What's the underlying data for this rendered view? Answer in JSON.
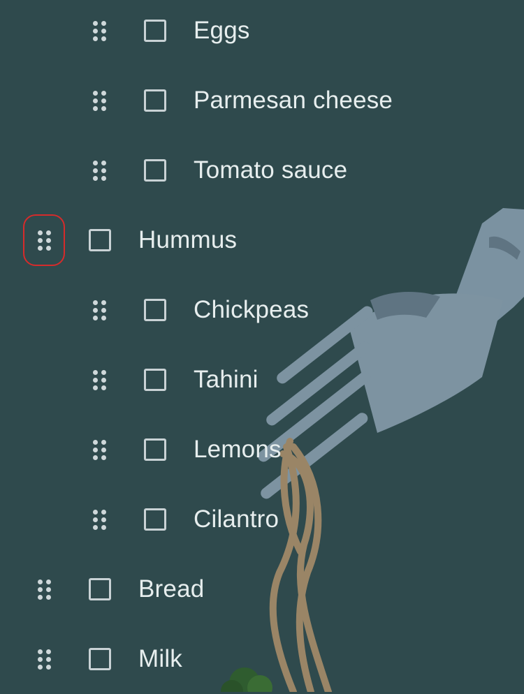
{
  "list": {
    "items": [
      {
        "label": "Eggs",
        "level": 1,
        "checked": false
      },
      {
        "label": "Parmesan cheese",
        "level": 1,
        "checked": false
      },
      {
        "label": "Tomato sauce",
        "level": 1,
        "checked": false
      },
      {
        "label": "Hummus",
        "level": 0,
        "checked": false,
        "highlighted": true
      },
      {
        "label": "Chickpeas",
        "level": 1,
        "checked": false
      },
      {
        "label": "Tahini",
        "level": 1,
        "checked": false
      },
      {
        "label": "Lemons",
        "level": 1,
        "checked": false
      },
      {
        "label": "Cilantro",
        "level": 1,
        "checked": false
      },
      {
        "label": "Bread",
        "level": 0,
        "checked": false
      },
      {
        "label": "Milk",
        "level": 0,
        "checked": false
      }
    ]
  },
  "theme": {
    "background": "#2f4a4d",
    "text": "#e7eeee",
    "checkbox_border": "#c9d2d5",
    "highlight": "#d62b2b",
    "fork": "#7d93a1",
    "noodle": "#9a8566"
  },
  "background_art": {
    "icon": "fork-with-pasta-illustration"
  }
}
